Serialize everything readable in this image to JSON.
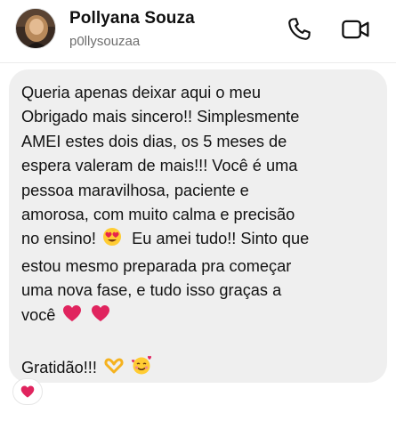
{
  "header": {
    "name": "Pollyana Souza",
    "handle": "p0llysouzaa"
  },
  "message": {
    "lines": [
      "Queria apenas deixar aqui o meu",
      "Obrigado mais sincero!! Simplesmente",
      "AMEI estes dois dias, os 5 meses de",
      "espera valeram de mais!!! Você é uma",
      "pessoa maravilhosa, paciente e",
      "amorosa, com muito calma e precisão",
      "no ensino!",
      "Eu amei tudo!! Sinto que",
      "estou mesmo preparada pra começar",
      "uma nova fase, e tudo isso graças a",
      "você",
      "Gratidão!!!"
    ],
    "emojis": {
      "heart_eyes": "heart-eyes-emoji",
      "heart": "red-heart-emoji",
      "heart_hands": "heart-hands-emoji",
      "smiling_hearts": "smiling-face-with-hearts-emoji"
    }
  },
  "reaction": {
    "emoji": "red-heart-emoji"
  },
  "colors": {
    "bubble": "#efefef",
    "heart": "#e0245e",
    "handle": "#6e6e6e"
  }
}
